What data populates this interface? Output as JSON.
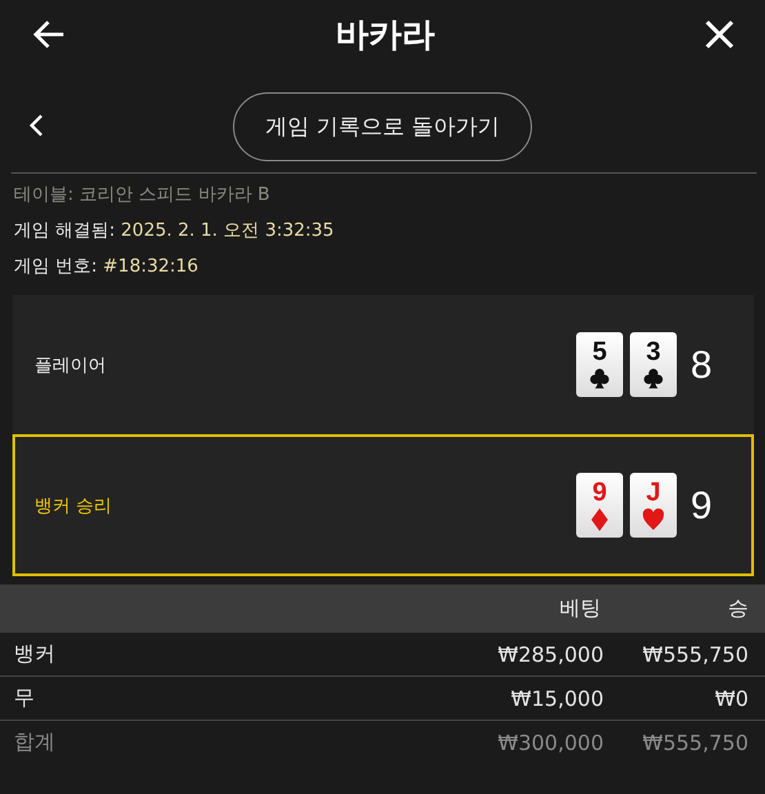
{
  "header": {
    "title": "바카라"
  },
  "back_link": {
    "label": "게임 기록으로 돌아가기"
  },
  "info": [
    {
      "label": "테이블:",
      "value": "코리안 스피드 바카라 B",
      "kind": "muted"
    },
    {
      "label": "게임 해결됨:",
      "value": "2025. 2. 1. 오전 3:32:35",
      "kind": "highlight"
    },
    {
      "label": "게임 번호:",
      "value": "#18:32:16",
      "kind": "highlight"
    }
  ],
  "hands": [
    {
      "label": "플레이어",
      "selected": false,
      "score": "8",
      "cards": [
        {
          "rank": "5",
          "kind": "clubs"
        },
        {
          "rank": "3",
          "kind": "clubs"
        }
      ]
    },
    {
      "label": "뱅커 승리",
      "selected": true,
      "score": "9",
      "cards": [
        {
          "rank": "9",
          "kind": "diamonds"
        },
        {
          "rank": "J",
          "kind": "hearts"
        }
      ]
    }
  ],
  "table": {
    "columns": [
      "베팅",
      "승"
    ],
    "rows": [
      {
        "kind": "bet",
        "name": "뱅커",
        "bet": "₩285,000",
        "win": "₩555,750"
      },
      {
        "kind": "bet",
        "name": "무",
        "bet": "₩15,000",
        "win": "₩0"
      },
      {
        "kind": "total",
        "name": "합계",
        "bet": "₩300,000",
        "win": "₩555,750"
      }
    ]
  }
}
